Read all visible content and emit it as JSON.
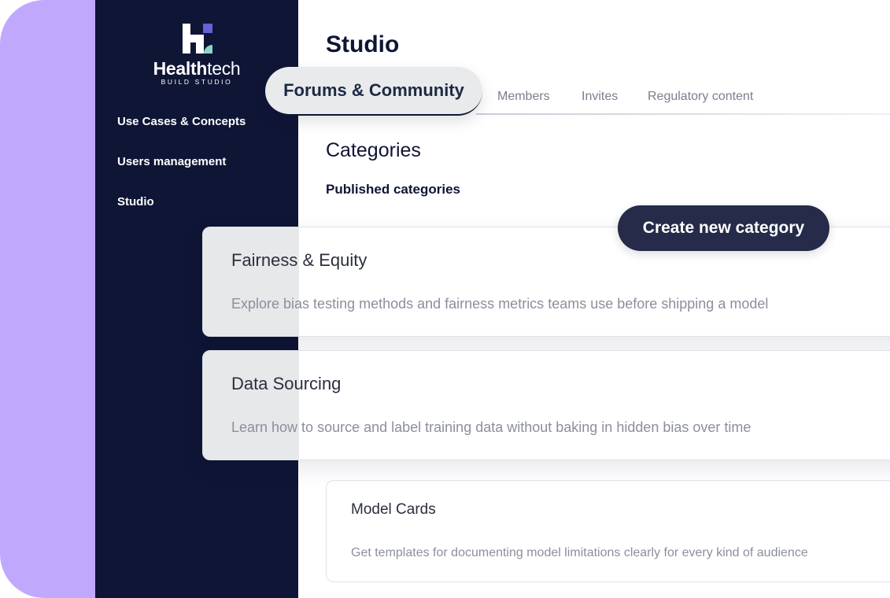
{
  "brand": {
    "name_bold": "Health",
    "name_regular": "tech",
    "subtitle": "BUILD STUDIO",
    "icon": "healthtech-logo-icon",
    "colors": {
      "white": "#ffffff",
      "purple": "#6a5fd6",
      "teal": "#8fd3c7"
    }
  },
  "sidebar": {
    "items": [
      {
        "label": "Use Cases & Concepts"
      },
      {
        "label": "Users management"
      },
      {
        "label": "Studio"
      }
    ]
  },
  "page": {
    "title": "Studio"
  },
  "tabs": [
    {
      "label": "Forums & Community",
      "active": true
    },
    {
      "label": "Members"
    },
    {
      "label": "Invites"
    },
    {
      "label": "Regulatory content"
    }
  ],
  "categories": {
    "title": "Categories",
    "subtitle": "Published categories",
    "create_label": "Create new category",
    "items": [
      {
        "title": "Fairness & Equity",
        "description": "Explore bias testing methods and fairness metrics teams use before shipping a model"
      },
      {
        "title": "Data Sourcing",
        "description": "Learn how to source and label training data without baking in hidden bias over time"
      },
      {
        "title": "Model Cards",
        "description": "Get templates for documenting model limitations clearly for every kind of audience"
      }
    ]
  },
  "colors": {
    "sidebar_bg": "#0f1535",
    "accent_purple": "#c0a9fc",
    "button_bg": "#252b48",
    "muted_text": "#8b8f9c"
  }
}
